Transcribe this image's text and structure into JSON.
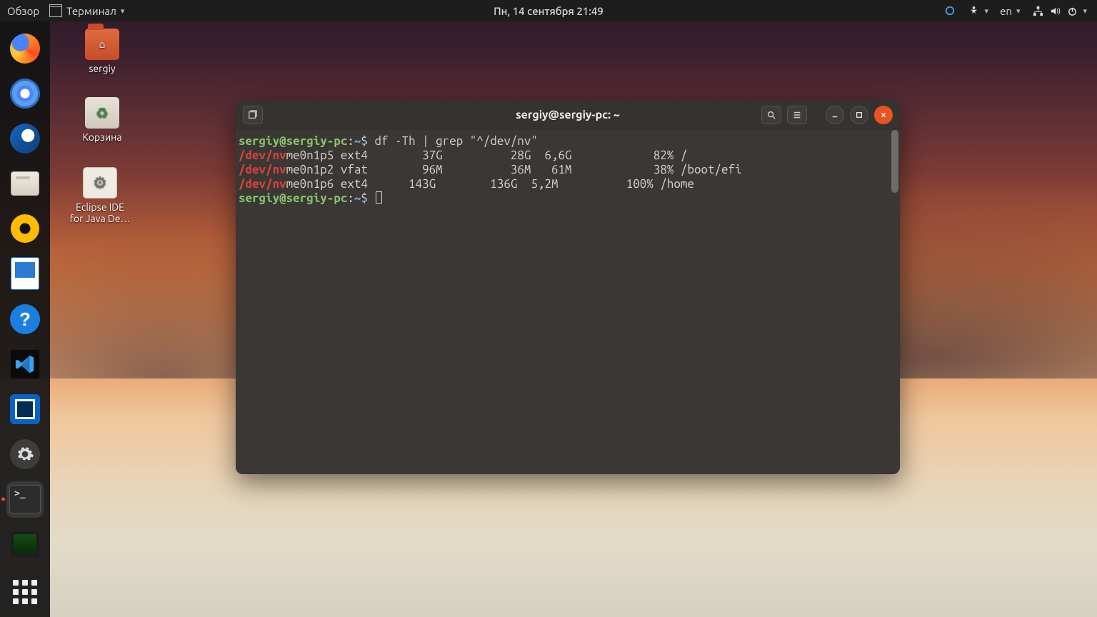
{
  "topbar": {
    "activities": "Обзор",
    "app_menu": "Терминал",
    "datetime": "Пн, 14 сентября  21:49",
    "lang": "en"
  },
  "desktop": {
    "home_label": "sergiy",
    "trash_label": "Корзина",
    "eclipse_label_l1": "Eclipse IDE",
    "eclipse_label_l2": "for Java De…"
  },
  "terminal": {
    "title": "sergiy@sergiy-pc: ~",
    "prompt": {
      "user": "sergiy",
      "at": "@",
      "host": "sergiy-pc",
      "colon": ":",
      "path": "~",
      "sigil": "$"
    },
    "cmd1": "df -Th | grep \"^/dev/nv\"",
    "match": "/dev/nv",
    "rows": [
      {
        "dev": "me0n1p5",
        "fs": "ext4",
        "size": " 37G",
        "used": " 28G",
        "avail": "6,6G",
        "pct": " 82%",
        "mnt": "/"
      },
      {
        "dev": "me0n1p2",
        "fs": "vfat",
        "size": " 96M",
        "used": " 36M",
        "avail": " 61M",
        "pct": " 38%",
        "mnt": "/boot/efi"
      },
      {
        "dev": "me0n1p6",
        "fs": "ext4",
        "size": "143G",
        "used": "136G",
        "avail": "5,2M",
        "pct": "100%",
        "mnt": "/home"
      }
    ]
  },
  "dock": {
    "items": [
      "firefox",
      "chromium",
      "thunderbird",
      "files",
      "rhythmbox",
      "libreoffice-writer",
      "help",
      "vscode",
      "virtualbox",
      "settings",
      "terminal",
      "putty"
    ]
  }
}
